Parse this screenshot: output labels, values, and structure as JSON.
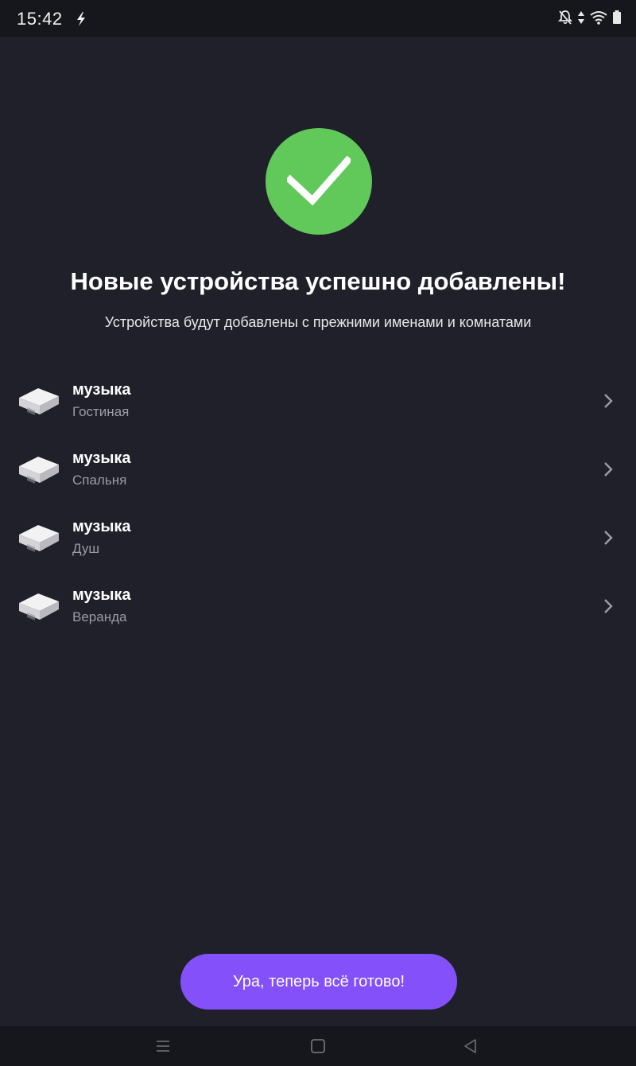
{
  "status_bar": {
    "time": "15:42",
    "icons": [
      "flash-icon",
      "notifications-off-icon",
      "data-arrows-icon",
      "wifi-icon",
      "battery-icon"
    ]
  },
  "success": {
    "icon": "checkmark-icon",
    "color": "#61c95a",
    "title": "Новые устройства успешно добавлены!",
    "subtitle": "Устройства будут добавлены с прежними именами и комнатами"
  },
  "devices": [
    {
      "name": "музыка",
      "room": "Гостиная"
    },
    {
      "name": "музыка",
      "room": "Спальня"
    },
    {
      "name": "музыка",
      "room": "Душ"
    },
    {
      "name": "музыка",
      "room": "Веранда"
    }
  ],
  "done_button": {
    "label": "Ура, теперь всё готово!",
    "color": "#8450fa"
  },
  "nav_bar": {
    "icons": [
      "menu-icon",
      "home-icon",
      "back-icon"
    ]
  }
}
